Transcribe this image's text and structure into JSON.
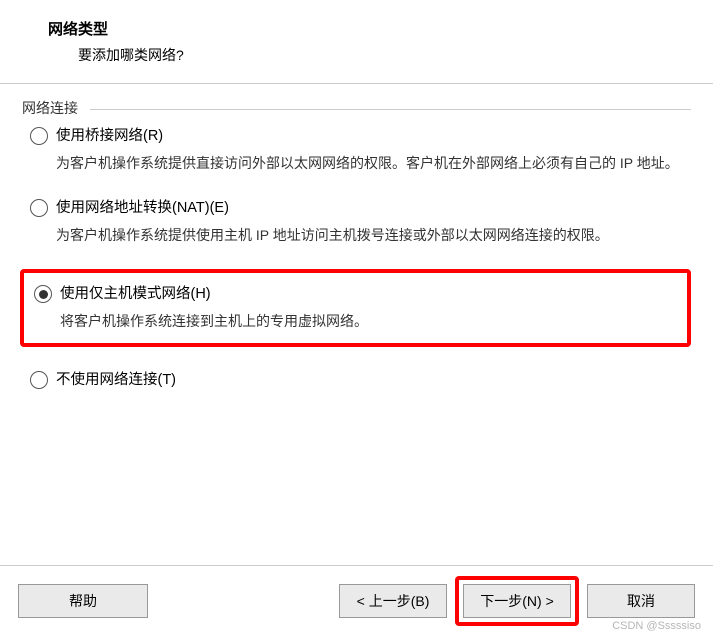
{
  "header": {
    "title": "网络类型",
    "subtitle": "要添加哪类网络?"
  },
  "fieldset": {
    "label": "网络连接"
  },
  "options": {
    "bridged": {
      "label": "使用桥接网络(R)",
      "desc": "为客户机操作系统提供直接访问外部以太网网络的权限。客户机在外部网络上必须有自己的 IP 地址。"
    },
    "nat": {
      "label": "使用网络地址转换(NAT)(E)",
      "desc": "为客户机操作系统提供使用主机 IP 地址访问主机拨号连接或外部以太网网络连接的权限。"
    },
    "hostonly": {
      "label": "使用仅主机模式网络(H)",
      "desc": "将客户机操作系统连接到主机上的专用虚拟网络。"
    },
    "none": {
      "label": "不使用网络连接(T)"
    }
  },
  "buttons": {
    "help": "帮助",
    "back": "< 上一步(B)",
    "next": "下一步(N) >",
    "cancel": "取消"
  },
  "watermark": "CSDN @Sssssiso"
}
